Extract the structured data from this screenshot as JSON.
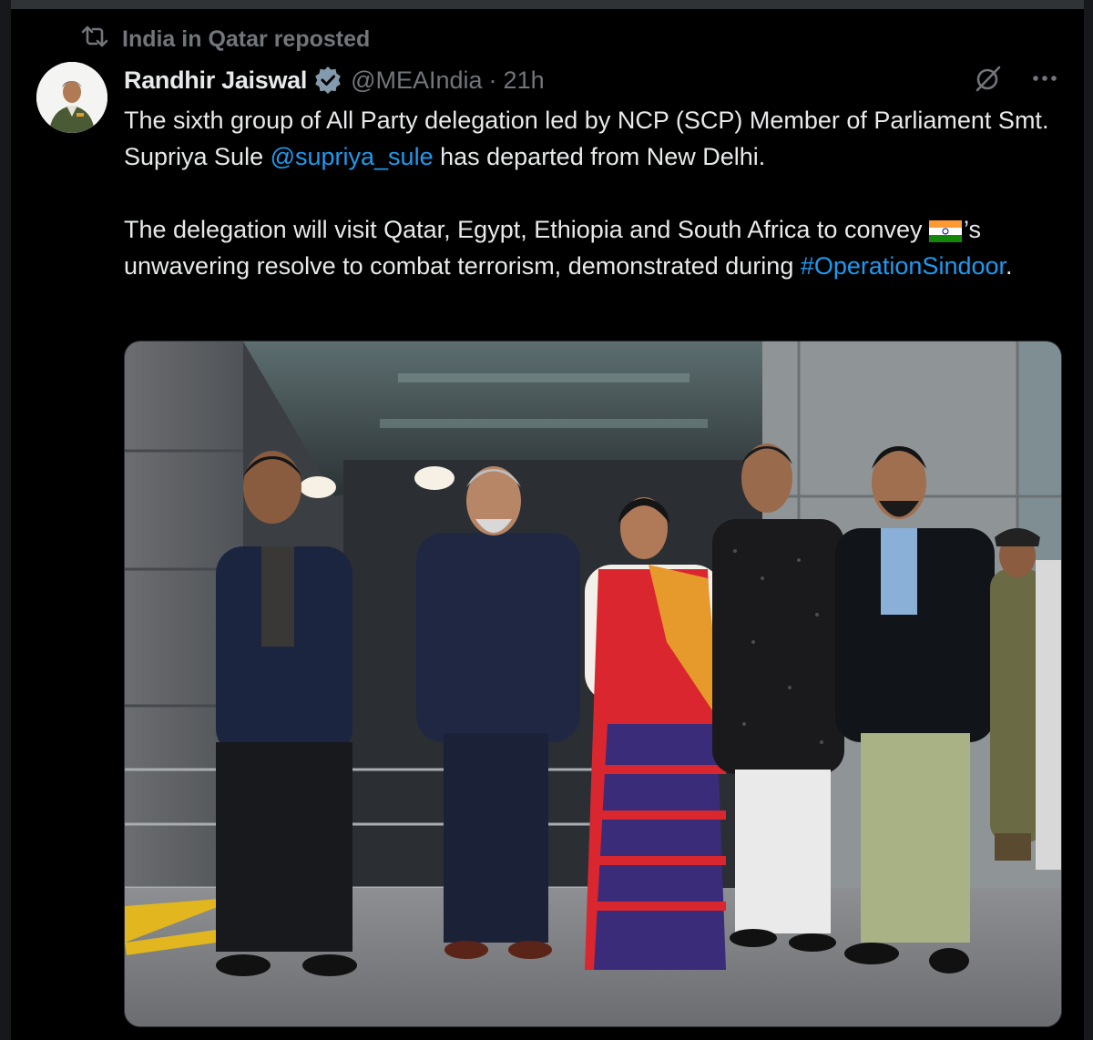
{
  "repost": {
    "label": "India in Qatar reposted",
    "icon": "repost-icon"
  },
  "author": {
    "name": "Randhir Jaiswal",
    "handle": "@MEAIndia",
    "separator": "·",
    "time": "21h",
    "verified": true
  },
  "actions": {
    "grok_icon": "grok-icon",
    "more_icon": "more-icon"
  },
  "tweet": {
    "p1_a": "The sixth group of All Party delegation led by NCP (SCP) Member of Parliament Smt. Supriya Sule ",
    "p1_mention": "@supriya_sule",
    "p1_b": " has departed from New Delhi.",
    "p2_a": "The delegation will visit Qatar, Egypt, Ethiopia and South Africa to convey ",
    "p2_flag": "india-flag-emoji",
    "p2_b": "’s unwavering resolve to combat terrorism, demonstrated during ",
    "p2_hashtag": "#OperationSindoor",
    "p2_c": "."
  },
  "colors": {
    "background": "#000000",
    "text": "#e7e9ea",
    "muted": "#71767b",
    "link": "#1d9bf0",
    "verified": "#829aab"
  }
}
